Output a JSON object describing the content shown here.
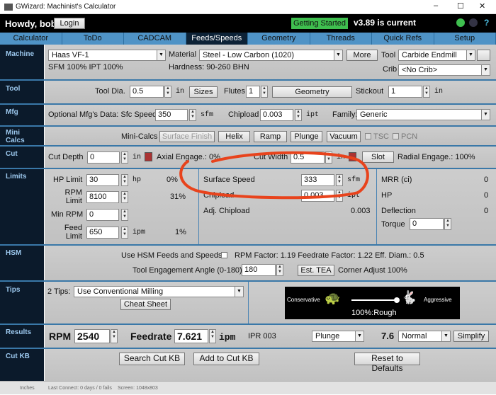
{
  "window": {
    "title": "GWizard: Machinist's Calculator",
    "minimize": "–",
    "maximize": "☐",
    "close": "✕"
  },
  "header": {
    "greeting": "Howdy, bob!",
    "login": "Login",
    "getting_started": "Getting Started",
    "version": "v3.89 is current"
  },
  "tabs": [
    {
      "label": "Calculator"
    },
    {
      "label": "ToDo"
    },
    {
      "label": "CADCAM"
    },
    {
      "label": "Feeds/Speeds",
      "active": true
    },
    {
      "label": "Geometry"
    },
    {
      "label": "Threads"
    },
    {
      "label": "Quick Refs"
    },
    {
      "label": "Setup"
    }
  ],
  "sections": {
    "machine": "Machine",
    "tool": "Tool",
    "mfg": "Mfg",
    "mini_calcs": "Mini Calcs",
    "cut": "Cut",
    "limits": "Limits",
    "hsm": "HSM",
    "tips": "Tips",
    "results": "Results",
    "cut_kb": "Cut KB"
  },
  "machine": {
    "machine": "Haas VF-1",
    "factors": "SFM 100% IPT 100%",
    "material_label": "Material",
    "material": "Steel - Low Carbon (1020)",
    "hardness": "Hardness: 90-260 BHN",
    "more": "More",
    "tool_label": "Tool",
    "tool": "Carbide Endmill",
    "crib_label": "Crib",
    "crib": "<No Crib>"
  },
  "tool": {
    "dia_label": "Tool Dia.",
    "dia": "0.5",
    "unit": "in",
    "sizes": "Sizes",
    "flutes_label": "Flutes",
    "flutes": "1",
    "geometry": "Geometry",
    "stickout_label": "Stickout",
    "stickout": "1",
    "stickout_unit": "in"
  },
  "mfg": {
    "label": "Optional Mfg's Data: Sfc Speed",
    "sfc": "350",
    "sfc_unit": "sfm",
    "chipload_label": "Chipload",
    "chipload": "0.003",
    "chipload_unit": "ipt",
    "family_label": "Family:",
    "family": "Generic"
  },
  "mini": {
    "label": "Mini-Calcs",
    "surface_finish": "Surface Finish",
    "helix": "Helix",
    "ramp": "Ramp",
    "plunge": "Plunge",
    "vacuum": "Vacuum",
    "tsc": "TSC",
    "pcn": "PCN"
  },
  "cut": {
    "depth_label": "Cut Depth",
    "depth": "0",
    "unit": "in",
    "axial": "Axial Engage.: 0%",
    "width_label": "Cut Width",
    "width": "0.5",
    "width_unit": "in",
    "slot": "Slot",
    "radial": "Radial Engage.: 100%"
  },
  "limits": {
    "hp_label": "HP Limit",
    "hp": "30",
    "hp_unit": "hp",
    "hp_pct": "0%",
    "rpm_label": "RPM Limit",
    "rpm": "8100",
    "rpm_pct": "31%",
    "minrpm_label": "Min RPM",
    "minrpm": "0",
    "feed_label": "Feed Limit",
    "feed": "650",
    "feed_unit": "ipm",
    "feed_pct": "1%",
    "ss_label": "Surface Speed",
    "ss": "333",
    "ss_unit": "sfm",
    "cl_label": "Chipload",
    "cl": "0.003",
    "cl_unit": "ipt",
    "adj_label": "Adj. Chipload",
    "adj": "0.003",
    "mrr_label": "MRR (ci)",
    "mrr": "0",
    "hp2_label": "HP",
    "hp2": "0",
    "defl_label": "Deflection",
    "defl": "0",
    "torque_label": "Torque",
    "torque": "0"
  },
  "hsm": {
    "use": "Use HSM Feeds and Speeds",
    "factors": "RPM Factor: 1.19 Feedrate Factor: 1.22 Eff. Diam.: 0.5",
    "tea_label": "Tool Engagement Angle (0-180)",
    "tea": "180",
    "est": "Est. TEA",
    "corner": "Corner Adjust 100%"
  },
  "tips": {
    "label": "2 Tips:",
    "tip": "Use Conventional Milling",
    "cheat": "Cheat Sheet",
    "conservative": "Conservative",
    "aggressive": "Aggressive",
    "slider_value": 1.0,
    "mode": "100%:Rough"
  },
  "results": {
    "rpm_label": "RPM",
    "rpm": "2540",
    "feed_label": "Feedrate",
    "feed": "7.621",
    "feed_unit": "ipm",
    "ipr": "IPR 003",
    "op": "Plunge",
    "num": "7.6",
    "mode": "Normal",
    "simplify": "Simplify"
  },
  "cutkb": {
    "search": "Search Cut KB",
    "add": "Add to Cut KB",
    "reset": "Reset to Defaults"
  },
  "status": {
    "units": "Inches",
    "last": "Last Connect: 0 days / 0 fails",
    "screen": "Screen: 1048x803"
  },
  "colors": {
    "annotation": "#e8431c",
    "accent": "#4f93c6",
    "sidebar": "#0b1a2b",
    "green": "#3fbf4f"
  }
}
